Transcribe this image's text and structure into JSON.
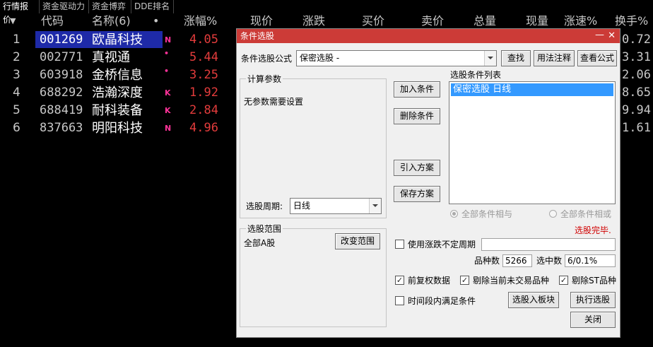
{
  "tabs": [
    "行情报价",
    "资金驱动力",
    "资金博弈",
    "DDE排名"
  ],
  "table": {
    "headers": {
      "sort_arrow": "▼",
      "code": "代码",
      "name": "名称(6)",
      "dot": "•",
      "change_pct": "涨幅%",
      "price": "现价",
      "change": "涨跌",
      "bid": "买价",
      "ask": "卖价",
      "volume": "总量",
      "cur_vol": "现量",
      "speed": "涨速%",
      "turnover": "换手%"
    },
    "rows": [
      {
        "idx": "1",
        "code": "001269",
        "name": "欧晶科技",
        "flag": "N",
        "pct": "4.05",
        "turnover": "0.72"
      },
      {
        "idx": "2",
        "code": "002771",
        "name": "真视通",
        "flag": "•",
        "pct": "5.44",
        "turnover": "3.31"
      },
      {
        "idx": "3",
        "code": "603918",
        "name": "金桥信息",
        "flag": "•",
        "pct": "3.25",
        "turnover": "2.06"
      },
      {
        "idx": "4",
        "code": "688292",
        "name": "浩瀚深度",
        "flag": "K",
        "pct": "1.92",
        "turnover": "8.65"
      },
      {
        "idx": "5",
        "code": "688419",
        "name": "耐科装备",
        "flag": "K",
        "pct": "2.84",
        "turnover": "9.94"
      },
      {
        "idx": "6",
        "code": "837663",
        "name": "明阳科技",
        "flag": "N",
        "pct": "4.96",
        "turnover": "1.61"
      }
    ]
  },
  "dialog": {
    "title": "条件选股",
    "minimize": "—",
    "close": "✕",
    "formula_label": "条件选股公式",
    "formula_value": "保密选股  -",
    "find_btn": "查找",
    "usage_btn": "用法注释",
    "view_btn": "查看公式",
    "calc_group": "计算参数",
    "no_params": "无参数需要设置",
    "period_label": "选股周期:",
    "period_value": "日线",
    "add_btn": "加入条件",
    "delete_btn": "删除条件",
    "import_btn": "引入方案",
    "save_btn": "保存方案",
    "cond_list_label": "选股条件列表",
    "cond_list_items": [
      "保密选股  日线"
    ],
    "radio_and": "全部条件相与",
    "radio_or": "全部条件相或",
    "status": "选股完毕.",
    "range_group": "选股范围",
    "range_value": "全部A股",
    "change_range_btn": "改变范围",
    "use_period_label": "使用涨跌不定周期",
    "count_label": "品种数",
    "count_value": "5266",
    "selected_label": "选中数",
    "selected_value": "6/0.1%",
    "fq_label": "前复权数据",
    "exclude_nontrading_label": "剔除当前未交易品种",
    "exclude_st_label": "剔除ST品种",
    "time_range_label": "时间段内满足条件",
    "to_block_btn": "选股入板块",
    "run_btn": "执行选股",
    "close_btn": "关闭"
  }
}
